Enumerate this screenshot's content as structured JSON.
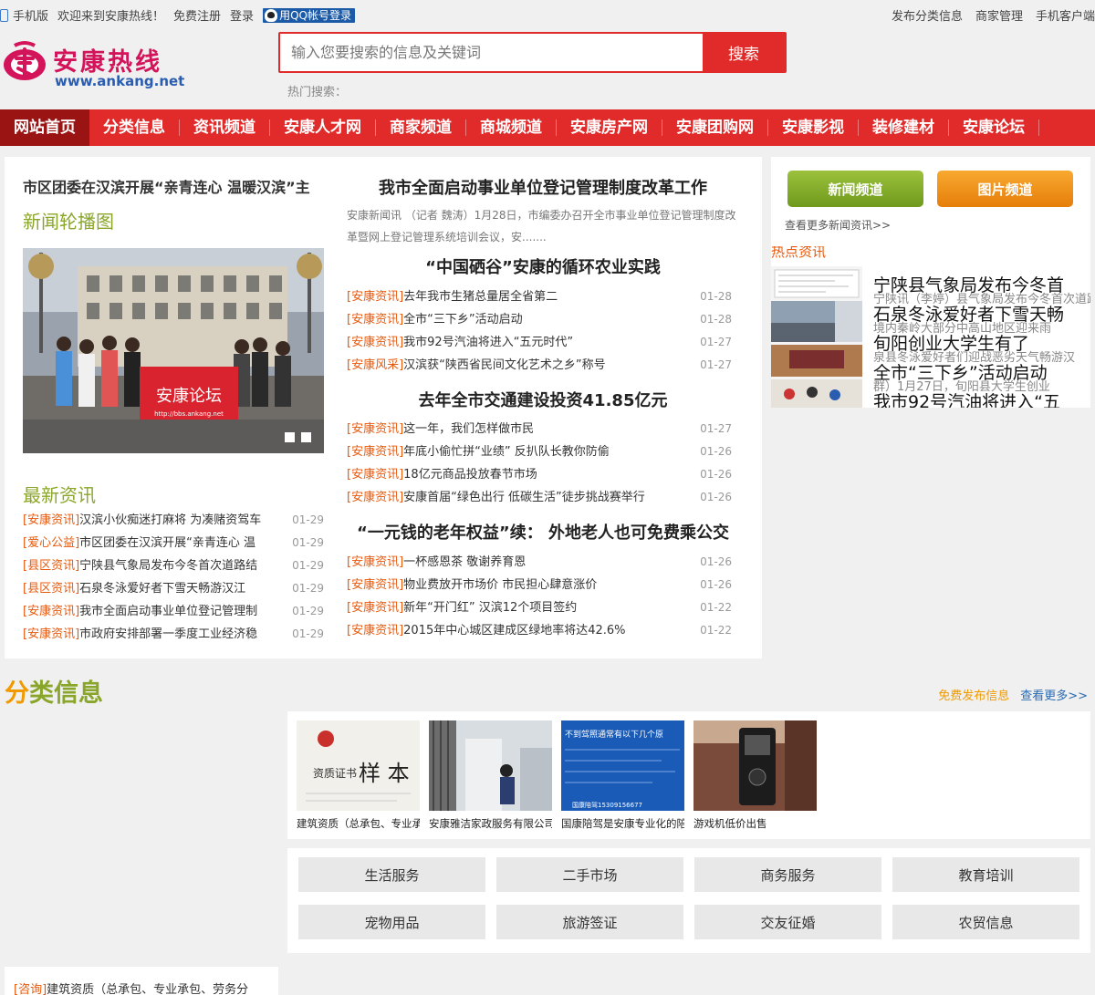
{
  "topbar": {
    "mobile": "手机版",
    "welcome": "欢迎来到安康热线！",
    "register": "免费注册",
    "login": "登录",
    "qq_login": "用QQ帐号登录",
    "right": [
      "发布分类信息",
      "商家管理",
      "手机客户端"
    ]
  },
  "logo": {
    "cn": "安康热线",
    "en": "www.ankang.net"
  },
  "search": {
    "placeholder": "输入您要搜索的信息及关键词",
    "button": "搜索",
    "hot_label": "热门搜索："
  },
  "nav": [
    "网站首页",
    "分类信息",
    "资讯频道",
    "安康人才网",
    "商家频道",
    "商城频道",
    "安康房产网",
    "安康团购网",
    "安康影视",
    "装修建材",
    "安康论坛"
  ],
  "main": {
    "slide_title": "市区团委在汉滨开展“亲青连心 温暖汉滨”主",
    "carousel_label": "新闻轮播图",
    "photo_banner": "安康论坛",
    "photo_url_text": "http://bbs.ankang.net",
    "latest_label": "最新资讯",
    "latest": [
      {
        "tag": "[安康资讯]",
        "title": "汉滨小伙痴迷打麻将 为凑赌资驾车",
        "date": "01-29"
      },
      {
        "tag": "[爱心公益]",
        "title": "市区团委在汉滨开展“亲青连心 温",
        "date": "01-29"
      },
      {
        "tag": "[县区资讯]",
        "title": "宁陕县气象局发布今冬首次道路结",
        "date": "01-29"
      },
      {
        "tag": "[县区资讯]",
        "title": "石泉冬泳爱好者下雪天畅游汉江",
        "date": "01-29"
      },
      {
        "tag": "[安康资讯]",
        "title": "我市全面启动事业单位登记管理制",
        "date": "01-29"
      },
      {
        "tag": "[安康资讯]",
        "title": "市政府安排部署一季度工业经济稳",
        "date": "01-29"
      }
    ],
    "headline1": "我市全面启动事业单位登记管理制度改革工作",
    "summary": "安康新闻讯 （记者 魏涛）1月28日，市编委办召开全市事业单位登记管理制度改革暨网上登记管理系统培训会议，安.......",
    "headline2": "“中国硒谷”安康的循环农业实践",
    "group2": [
      {
        "tag": "[安康资讯]",
        "title": "去年我市生猪总量居全省第二",
        "date": "01-28"
      },
      {
        "tag": "[安康资讯]",
        "title": "全市“三下乡”活动启动",
        "date": "01-28"
      },
      {
        "tag": "[安康资讯]",
        "title": "我市92号汽油将进入“五元时代”",
        "date": "01-27"
      },
      {
        "tag": "[安康风采]",
        "title": "汉滨获“陕西省民间文化艺术之乡”称号",
        "date": "01-27"
      }
    ],
    "headline3": "去年全市交通建设投资41.85亿元",
    "group3": [
      {
        "tag": "[安康资讯]",
        "title": "这一年，我们怎样做市民",
        "date": "01-27"
      },
      {
        "tag": "[安康资讯]",
        "title": "年底小偷忙拼“业绩” 反扒队长教你防偷",
        "date": "01-26"
      },
      {
        "tag": "[安康资讯]",
        "title": "18亿元商品投放春节市场",
        "date": "01-26"
      },
      {
        "tag": "[安康资讯]",
        "title": "安康首届“绿色出行 低碳生活”徒步挑战赛举行",
        "date": "01-26"
      }
    ],
    "headline4": "“一元钱的老年权益”续： 外地老人也可免费乘公交",
    "group4": [
      {
        "tag": "[安康资讯]",
        "title": "一杯感恩茶 敬谢养育恩",
        "date": "01-26"
      },
      {
        "tag": "[安康资讯]",
        "title": "物业费放开市场价 市民担心肆意涨价",
        "date": "01-26"
      },
      {
        "tag": "[安康资讯]",
        "title": "新年“开门红” 汉滨12个项目签约",
        "date": "01-22"
      },
      {
        "tag": "[安康资讯]",
        "title": "2015年中心城区建成区绿地率将达42.6%",
        "date": "01-22"
      }
    ]
  },
  "side": {
    "news_btn": "新闻频道",
    "pic_btn": "图片频道",
    "more": "查看更多新闻资讯>>",
    "hot_label": "热点资讯",
    "lines": [
      {
        "title": "宁陕县气象局发布今冬首",
        "sub": "宁陕讯（李婷）县气象局发布今冬首次道路结冰黄色预警，受强冷空气影响"
      },
      {
        "title": "石泉冬泳爱好者下雪天畅",
        "sub": "境内秦岭大部分中高山地区迎来雨"
      },
      {
        "title": "旬阳创业大学生有了",
        "sub": "泉县冬泳爱好者们迎战恶劣天气畅游汉"
      },
      {
        "title": "全市“三下乡”活动启动",
        "sub": "群）1月27日，旬阳县大学生创业"
      },
      {
        "title": "我市92号汽油将进入“五",
        "sub": ""
      }
    ]
  },
  "classified": {
    "title_first": "分",
    "title_rest": "类信息",
    "free_post": "免费发布信息",
    "more": "查看更多>>",
    "gallery": [
      {
        "caption": "建筑资质（总承包、专业承包",
        "stamp": "样 本",
        "cert": "资质证书"
      },
      {
        "caption": "安康雅洁家政服务有限公司",
        "stamp": "",
        "cert": ""
      },
      {
        "caption": "国康陪驾是安康专业化的陪驾",
        "stamp": "不到驾照通常有以下几个原",
        "cert": "国康陪驾15309156677"
      },
      {
        "caption": "游戏机低价出售",
        "stamp": "",
        "cert": ""
      }
    ],
    "categories": [
      "生活服务",
      "二手市场",
      "商务服务",
      "教育培训",
      "宠物用品",
      "旅游签证",
      "交友征婚",
      "农贸信息"
    ]
  },
  "bottom": {
    "tag": "[咨询]",
    "text": "建筑资质（总承包、专业承包、劳务分"
  },
  "colors": {
    "nav": "#e12b2b",
    "nav_active": "#9b1414",
    "accent_green": "#8aa62a",
    "tag_orange": "#e8590c",
    "logo_pink": "#d4145a"
  }
}
